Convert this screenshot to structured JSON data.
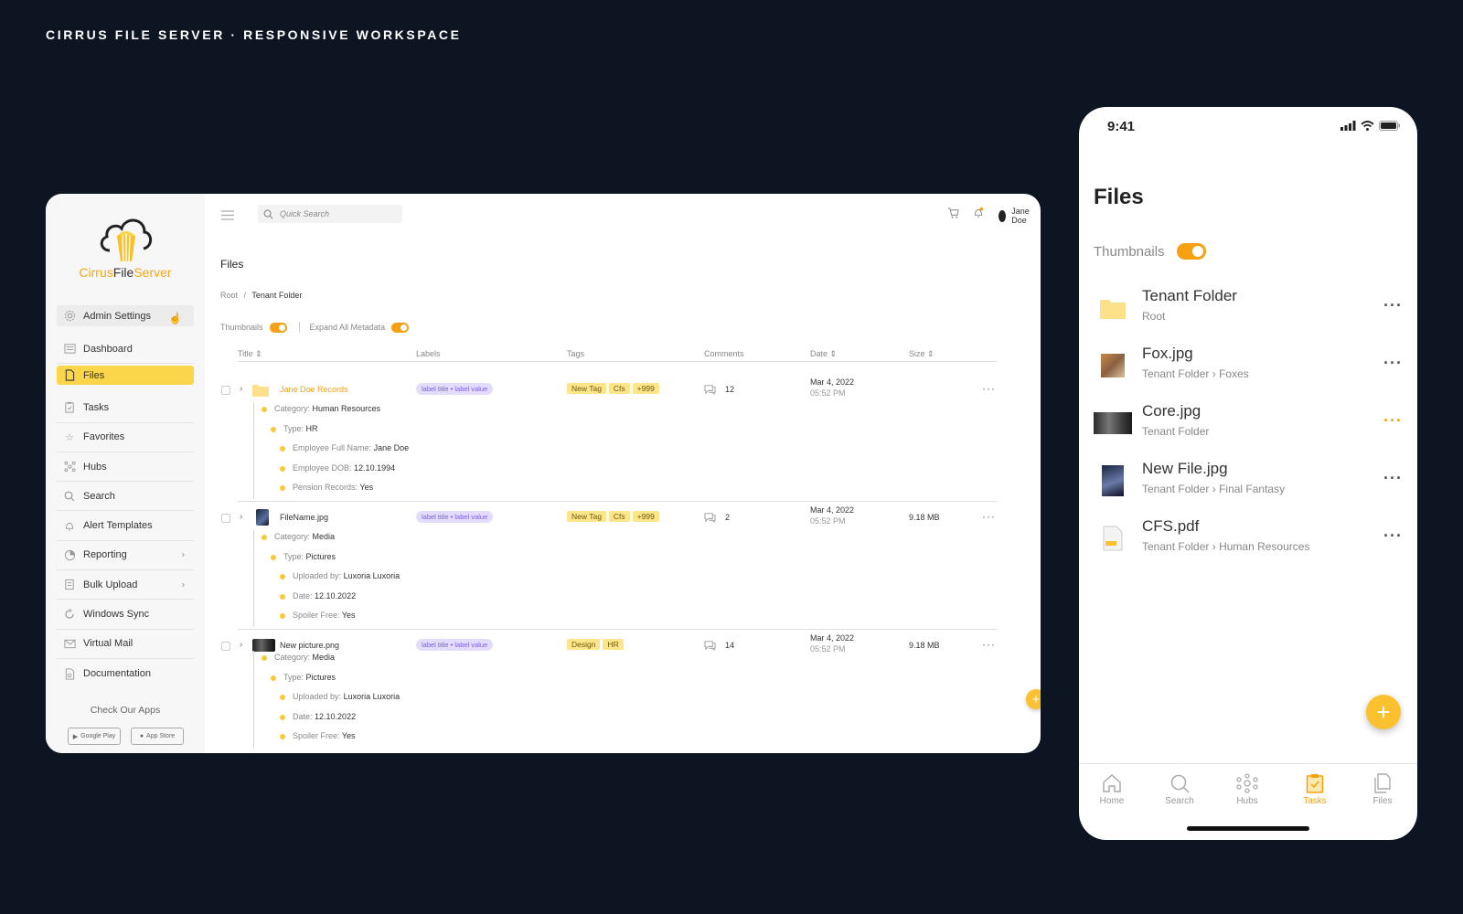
{
  "page_title": "CIRRUS FILE SERVER · RESPONSIVE WORKSPACE",
  "colors": {
    "accent": "#f6a112",
    "highlight": "#fbd54a",
    "label_purple": "#e3dcfd",
    "tag_yellow": "#fde58a",
    "background": "#0d1522"
  },
  "desktop": {
    "logo": {
      "part1": "Cirrus",
      "part2": "File",
      "part3": "Server"
    },
    "sidebar": {
      "items": [
        {
          "label": "Admin Settings",
          "icon": "gear-icon"
        },
        {
          "label": "Dashboard",
          "icon": "dashboard-icon"
        },
        {
          "label": "Files",
          "icon": "file-icon"
        },
        {
          "label": "Tasks",
          "icon": "clipboard-icon"
        },
        {
          "label": "Favorites",
          "icon": "star-icon"
        },
        {
          "label": "Hubs",
          "icon": "hubs-icon"
        },
        {
          "label": "Search",
          "icon": "search-icon"
        },
        {
          "label": "Alert Templates",
          "icon": "bell-icon"
        },
        {
          "label": "Reporting",
          "icon": "report-icon"
        },
        {
          "label": "Bulk Upload",
          "icon": "upload-icon"
        },
        {
          "label": "Windows Sync",
          "icon": "sync-icon"
        },
        {
          "label": "Virtual Mail",
          "icon": "mail-icon"
        },
        {
          "label": "Documentation",
          "icon": "doc-icon"
        }
      ],
      "apps_title": "Check Our Apps",
      "google_play": "Google Play",
      "app_store": "App Store"
    },
    "topbar": {
      "search_placeholder": "Quick Search",
      "user_name": "Jane Doe"
    },
    "title": "Files",
    "breadcrumb": {
      "root": "Root",
      "sep": "/",
      "current": "Tenant Folder"
    },
    "toggles": {
      "thumbnails": "Thumbnails",
      "expand": "Expand All Metadata"
    },
    "columns": {
      "title": "Title ⇕",
      "labels": "Labels",
      "tags": "Tags",
      "comments": "Comments",
      "date": "Date ⇕",
      "size": "Size ⇕"
    },
    "rows": [
      {
        "name": "Jane Doe Records",
        "label": "label title • label value",
        "tags": [
          "New Tag",
          "Cfs",
          "+999"
        ],
        "comments": "12",
        "date": "Mar 4, 2022",
        "time": "05:52 PM",
        "size": "",
        "meta": [
          {
            "k": "Category:",
            "v": "Human Resources"
          },
          {
            "k": "Type:",
            "v": "HR"
          },
          {
            "k": "Employee Full Name:",
            "v": "Jane Doe"
          },
          {
            "k": "Employee DOB:",
            "v": "12.10.1994"
          },
          {
            "k": "Pension Records:",
            "v": "Yes"
          }
        ]
      },
      {
        "name": "FileName.jpg",
        "label": "label title • label value",
        "tags": [
          "New Tag",
          "Cfs",
          "+999"
        ],
        "comments": "2",
        "date": "Mar 4, 2022",
        "time": "05:52 PM",
        "size": "9.18 MB",
        "meta": [
          {
            "k": "Category:",
            "v": "Media"
          },
          {
            "k": "Type:",
            "v": "Pictures"
          },
          {
            "k": "Uploaded by:",
            "v": "Luxoria Luxoria"
          },
          {
            "k": "Date:",
            "v": "12.10.2022"
          },
          {
            "k": "Spoiler Free:",
            "v": "Yes"
          }
        ]
      },
      {
        "name": "New picture.png",
        "label": "label title • label value",
        "tags": [
          "Design",
          "HR"
        ],
        "comments": "14",
        "date": "Mar 4, 2022",
        "time": "05:52 PM",
        "size": "9.18 MB",
        "meta": [
          {
            "k": "Category:",
            "v": "Media"
          },
          {
            "k": "Type:",
            "v": "Pictures"
          },
          {
            "k": "Uploaded by:",
            "v": "Luxoria Luxoria"
          },
          {
            "k": "Date:",
            "v": "12.10.2022"
          },
          {
            "k": "Spoiler Free:",
            "v": "Yes"
          }
        ]
      }
    ],
    "fab": "+"
  },
  "mobile": {
    "time": "9:41",
    "title": "Files",
    "thumbnails_label": "Thumbnails",
    "items": [
      {
        "name": "Tenant Folder",
        "path": [
          "Root"
        ]
      },
      {
        "name": "Fox.jpg",
        "path": [
          "Tenant Folder",
          "Foxes"
        ]
      },
      {
        "name": "Core.jpg",
        "path": [
          "Tenant Folder"
        ]
      },
      {
        "name": "New File.jpg",
        "path": [
          "Tenant Folder",
          "Final Fantasy"
        ]
      },
      {
        "name": "CFS.pdf",
        "path": [
          "Tenant Folder",
          "Human Resources"
        ]
      }
    ],
    "fab": "+",
    "tabs": [
      {
        "label": "Home",
        "icon": "home-icon"
      },
      {
        "label": "Search",
        "icon": "search-icon"
      },
      {
        "label": "Hubs",
        "icon": "hubs-icon"
      },
      {
        "label": "Tasks",
        "icon": "clipboard-icon",
        "active": true
      },
      {
        "label": "Files",
        "icon": "files-icon"
      }
    ]
  }
}
